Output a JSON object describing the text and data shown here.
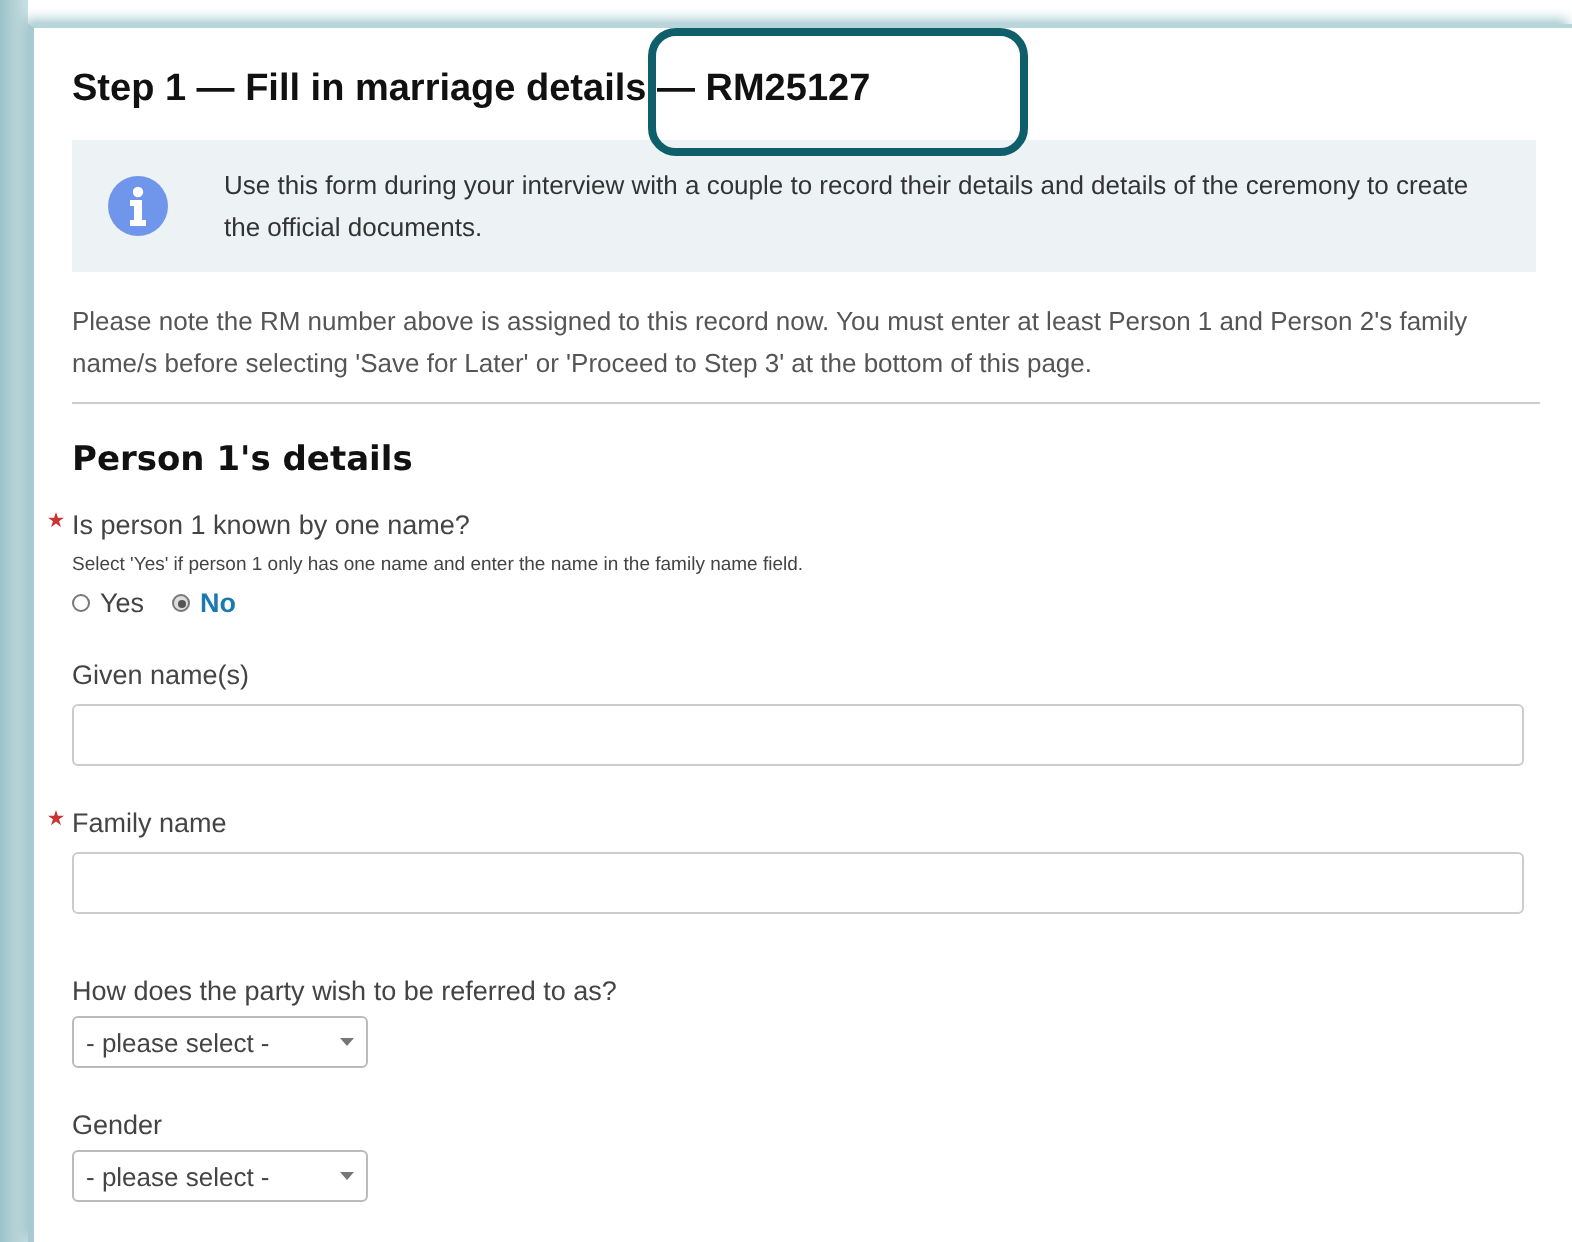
{
  "title": "Step 1 — Fill in marriage details — RM25127",
  "info": "Use this form during your interview with a couple to record their details and details of the ceremony to create the official documents.",
  "note": "Please note the RM number above is assigned to this record now. You must enter at least Person 1 and Person 2's family name/s before selecting 'Save for Later' or 'Proceed to Step 3' at the bottom of this page.",
  "section": "Person 1's details",
  "fields": [
    {
      "kind": "radio",
      "label": "Is person 1 known by one name?",
      "required": true,
      "hint": "Select 'Yes' if person 1 only has one name and enter the name in the family name field.",
      "options": [
        {
          "label": "Yes",
          "selected": false
        },
        {
          "label": "No",
          "selected": true
        }
      ]
    },
    {
      "kind": "text",
      "label": "Given name(s)",
      "required": false
    },
    {
      "kind": "text",
      "label": "Family name",
      "required": true
    },
    {
      "kind": "select",
      "label": "How does the party wish to be referred to as?",
      "required": false,
      "value": "- please select -"
    },
    {
      "kind": "select",
      "label": "Gender",
      "required": false,
      "value": "- please select -"
    }
  ]
}
